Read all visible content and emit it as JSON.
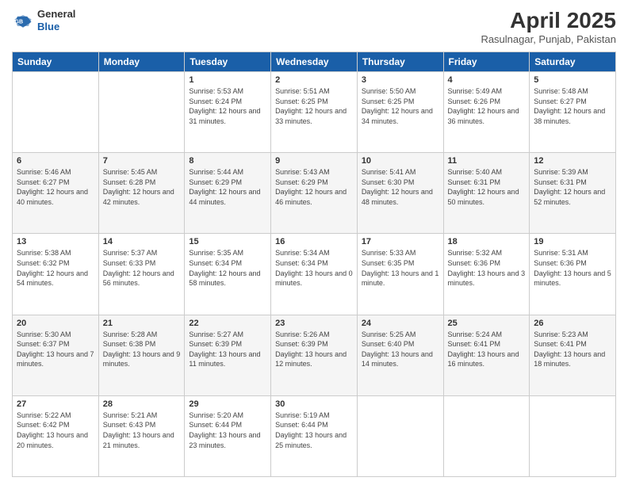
{
  "header": {
    "logo_general": "General",
    "logo_blue": "Blue",
    "title": "April 2025",
    "subtitle": "Rasulnagar, Punjab, Pakistan"
  },
  "weekdays": [
    "Sunday",
    "Monday",
    "Tuesday",
    "Wednesday",
    "Thursday",
    "Friday",
    "Saturday"
  ],
  "weeks": [
    [
      {
        "day": "",
        "info": ""
      },
      {
        "day": "",
        "info": ""
      },
      {
        "day": "1",
        "info": "Sunrise: 5:53 AM\nSunset: 6:24 PM\nDaylight: 12 hours and 31 minutes."
      },
      {
        "day": "2",
        "info": "Sunrise: 5:51 AM\nSunset: 6:25 PM\nDaylight: 12 hours and 33 minutes."
      },
      {
        "day": "3",
        "info": "Sunrise: 5:50 AM\nSunset: 6:25 PM\nDaylight: 12 hours and 34 minutes."
      },
      {
        "day": "4",
        "info": "Sunrise: 5:49 AM\nSunset: 6:26 PM\nDaylight: 12 hours and 36 minutes."
      },
      {
        "day": "5",
        "info": "Sunrise: 5:48 AM\nSunset: 6:27 PM\nDaylight: 12 hours and 38 minutes."
      }
    ],
    [
      {
        "day": "6",
        "info": "Sunrise: 5:46 AM\nSunset: 6:27 PM\nDaylight: 12 hours and 40 minutes."
      },
      {
        "day": "7",
        "info": "Sunrise: 5:45 AM\nSunset: 6:28 PM\nDaylight: 12 hours and 42 minutes."
      },
      {
        "day": "8",
        "info": "Sunrise: 5:44 AM\nSunset: 6:29 PM\nDaylight: 12 hours and 44 minutes."
      },
      {
        "day": "9",
        "info": "Sunrise: 5:43 AM\nSunset: 6:29 PM\nDaylight: 12 hours and 46 minutes."
      },
      {
        "day": "10",
        "info": "Sunrise: 5:41 AM\nSunset: 6:30 PM\nDaylight: 12 hours and 48 minutes."
      },
      {
        "day": "11",
        "info": "Sunrise: 5:40 AM\nSunset: 6:31 PM\nDaylight: 12 hours and 50 minutes."
      },
      {
        "day": "12",
        "info": "Sunrise: 5:39 AM\nSunset: 6:31 PM\nDaylight: 12 hours and 52 minutes."
      }
    ],
    [
      {
        "day": "13",
        "info": "Sunrise: 5:38 AM\nSunset: 6:32 PM\nDaylight: 12 hours and 54 minutes."
      },
      {
        "day": "14",
        "info": "Sunrise: 5:37 AM\nSunset: 6:33 PM\nDaylight: 12 hours and 56 minutes."
      },
      {
        "day": "15",
        "info": "Sunrise: 5:35 AM\nSunset: 6:34 PM\nDaylight: 12 hours and 58 minutes."
      },
      {
        "day": "16",
        "info": "Sunrise: 5:34 AM\nSunset: 6:34 PM\nDaylight: 13 hours and 0 minutes."
      },
      {
        "day": "17",
        "info": "Sunrise: 5:33 AM\nSunset: 6:35 PM\nDaylight: 13 hours and 1 minute."
      },
      {
        "day": "18",
        "info": "Sunrise: 5:32 AM\nSunset: 6:36 PM\nDaylight: 13 hours and 3 minutes."
      },
      {
        "day": "19",
        "info": "Sunrise: 5:31 AM\nSunset: 6:36 PM\nDaylight: 13 hours and 5 minutes."
      }
    ],
    [
      {
        "day": "20",
        "info": "Sunrise: 5:30 AM\nSunset: 6:37 PM\nDaylight: 13 hours and 7 minutes."
      },
      {
        "day": "21",
        "info": "Sunrise: 5:28 AM\nSunset: 6:38 PM\nDaylight: 13 hours and 9 minutes."
      },
      {
        "day": "22",
        "info": "Sunrise: 5:27 AM\nSunset: 6:39 PM\nDaylight: 13 hours and 11 minutes."
      },
      {
        "day": "23",
        "info": "Sunrise: 5:26 AM\nSunset: 6:39 PM\nDaylight: 13 hours and 12 minutes."
      },
      {
        "day": "24",
        "info": "Sunrise: 5:25 AM\nSunset: 6:40 PM\nDaylight: 13 hours and 14 minutes."
      },
      {
        "day": "25",
        "info": "Sunrise: 5:24 AM\nSunset: 6:41 PM\nDaylight: 13 hours and 16 minutes."
      },
      {
        "day": "26",
        "info": "Sunrise: 5:23 AM\nSunset: 6:41 PM\nDaylight: 13 hours and 18 minutes."
      }
    ],
    [
      {
        "day": "27",
        "info": "Sunrise: 5:22 AM\nSunset: 6:42 PM\nDaylight: 13 hours and 20 minutes."
      },
      {
        "day": "28",
        "info": "Sunrise: 5:21 AM\nSunset: 6:43 PM\nDaylight: 13 hours and 21 minutes."
      },
      {
        "day": "29",
        "info": "Sunrise: 5:20 AM\nSunset: 6:44 PM\nDaylight: 13 hours and 23 minutes."
      },
      {
        "day": "30",
        "info": "Sunrise: 5:19 AM\nSunset: 6:44 PM\nDaylight: 13 hours and 25 minutes."
      },
      {
        "day": "",
        "info": ""
      },
      {
        "day": "",
        "info": ""
      },
      {
        "day": "",
        "info": ""
      }
    ]
  ]
}
